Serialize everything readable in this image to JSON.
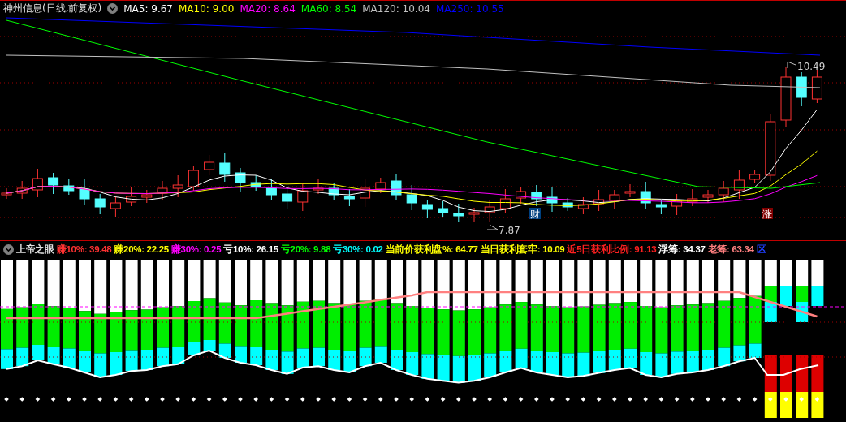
{
  "main_chart": {
    "title": "神州信息(日线,前复权)",
    "moving_averages": [
      {
        "label": "MA5:",
        "value": "9.67",
        "color": "#ffffff"
      },
      {
        "label": "MA10:",
        "value": "9.00",
        "color": "#ffff00"
      },
      {
        "label": "MA20:",
        "value": "8.64",
        "color": "#ff00ff"
      },
      {
        "label": "MA60:",
        "value": "8.54",
        "color": "#00ff00"
      },
      {
        "label": "MA120:",
        "value": "10.04",
        "color": "#c0c0c0"
      },
      {
        "label": "MA250:",
        "value": "10.55",
        "color": "#0000ff"
      }
    ],
    "high_label": "10.49",
    "low_label": "7.87",
    "markers": [
      {
        "text": "财",
        "color": "#004080"
      },
      {
        "text": "涨",
        "color": "#800000"
      }
    ]
  },
  "indicator": {
    "title": "上帝之眼",
    "items": [
      {
        "label": "赚10%:",
        "value": "39.48",
        "color": "#ff3232"
      },
      {
        "label": "赚20%:",
        "value": "22.25",
        "color": "#ffff00"
      },
      {
        "label": "赚30%:",
        "value": "0.25",
        "color": "#ff00ff"
      },
      {
        "label": "亏10%:",
        "value": "26.15",
        "color": "#ffffff"
      },
      {
        "label": "亏20%:",
        "value": "9.88",
        "color": "#00ff00"
      },
      {
        "label": "亏30%:",
        "value": "0.02",
        "color": "#00ffff"
      },
      {
        "label": "当前价获利盘%:",
        "value": "64.77",
        "color": "#ffff00"
      },
      {
        "label": "当日获利套牢:",
        "value": "10.09",
        "color": "#ffff00"
      },
      {
        "label": "近5日获利比例:",
        "value": "91.13",
        "color": "#ff2020"
      },
      {
        "label": "浮筹:",
        "value": "34.37",
        "color": "#ffffff"
      },
      {
        "label": "老筹:",
        "value": "63.34",
        "color": "#ff8080"
      },
      {
        "label": "区",
        "color": "#2040ff"
      }
    ]
  }
}
